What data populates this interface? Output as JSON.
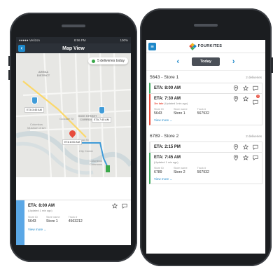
{
  "left_phone": {
    "status": {
      "carrier": "●●●●● Verizon",
      "time": "8:56 PM",
      "battery": "100%"
    },
    "header": {
      "title": "Map View",
      "back_icon": "chevron-left-icon"
    },
    "map": {
      "deliveries_pill": "5 deliveries today",
      "labels": [
        "ARENA DISTRICT",
        "HIGH STREET CORRIDOR",
        "Columbus Museum of Art",
        "Goodale St",
        "Broad St",
        "City Center",
        "Columbus Commons"
      ],
      "eta_tags": [
        "ETA 3:45 AM",
        "ETA 7:45 AM",
        "ETA 8:00 AM"
      ]
    },
    "card": {
      "eta": "ETA: 8:00 AM",
      "updated": "(Updated 1 min ago)",
      "fields": [
        {
          "label": "Store ID",
          "value": "5643"
        },
        {
          "label": "Store name",
          "value": "Store 1"
        },
        {
          "label": "Truck #",
          "value": "4563212"
        }
      ],
      "view_more": "View more ⌄"
    }
  },
  "right_phone": {
    "brand": "FOURKITES",
    "date_label": "Today",
    "stores": [
      {
        "name": "5643 - Store 1",
        "count": "2 deliveries",
        "stops": [
          {
            "eta": "ETA: 8:00 AM",
            "status": "green"
          },
          {
            "eta": "ETA: 7:30 AM",
            "late": "1hr late",
            "late_note": "(Updated 1min ago)",
            "badge": "3",
            "fields": [
              {
                "label": "Store ID",
                "value": "5643"
              },
              {
                "label": "Store name",
                "value": "Store 1"
              },
              {
                "label": "Truck #",
                "value": "567932"
              }
            ],
            "view_more": "View more ⌄"
          }
        ]
      },
      {
        "name": "6789 - Store 2",
        "count": "2 deliveries",
        "stops": [
          {
            "eta": "ETA: 2:15 PM"
          },
          {
            "eta": "ETA: 7:45 AM",
            "updated": "(Updated 1 min ago)",
            "fields": [
              {
                "label": "Store ID",
                "value": "6789"
              },
              {
                "label": "Store name",
                "value": "Store 2"
              },
              {
                "label": "Truck #",
                "value": "567932"
              }
            ],
            "view_more": "View more ⌄"
          }
        ]
      }
    ]
  },
  "colors": {
    "accent": "#1e88c9",
    "green": "#41a85f",
    "red": "#e74c3c",
    "dark": "#2c3138"
  }
}
